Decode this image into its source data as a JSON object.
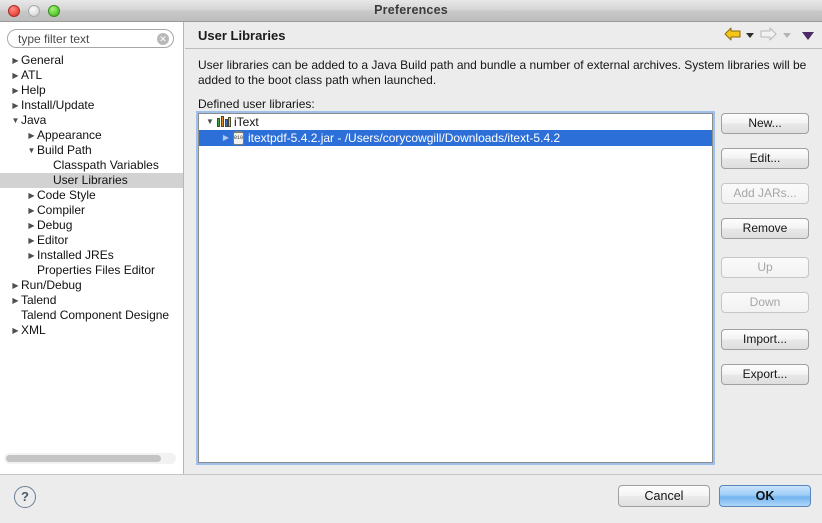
{
  "window": {
    "title": "Preferences"
  },
  "sidebar": {
    "filter": {
      "placeholder": "type filter text",
      "value": "",
      "clear_icon": "clear-circle-icon"
    },
    "items": [
      {
        "label": "General",
        "depth": 0,
        "twisty": "collapsed",
        "selected": false
      },
      {
        "label": "ATL",
        "depth": 0,
        "twisty": "collapsed",
        "selected": false
      },
      {
        "label": "Help",
        "depth": 0,
        "twisty": "collapsed",
        "selected": false
      },
      {
        "label": "Install/Update",
        "depth": 0,
        "twisty": "collapsed",
        "selected": false
      },
      {
        "label": "Java",
        "depth": 0,
        "twisty": "expanded",
        "selected": false
      },
      {
        "label": "Appearance",
        "depth": 1,
        "twisty": "collapsed",
        "selected": false
      },
      {
        "label": "Build Path",
        "depth": 1,
        "twisty": "expanded",
        "selected": false
      },
      {
        "label": "Classpath Variables",
        "depth": 2,
        "twisty": "none",
        "selected": false
      },
      {
        "label": "User Libraries",
        "depth": 2,
        "twisty": "none",
        "selected": true
      },
      {
        "label": "Code Style",
        "depth": 1,
        "twisty": "collapsed",
        "selected": false
      },
      {
        "label": "Compiler",
        "depth": 1,
        "twisty": "collapsed",
        "selected": false
      },
      {
        "label": "Debug",
        "depth": 1,
        "twisty": "collapsed",
        "selected": false
      },
      {
        "label": "Editor",
        "depth": 1,
        "twisty": "collapsed",
        "selected": false
      },
      {
        "label": "Installed JREs",
        "depth": 1,
        "twisty": "collapsed",
        "selected": false
      },
      {
        "label": "Properties Files Editor",
        "depth": 1,
        "twisty": "none",
        "selected": false
      },
      {
        "label": "Run/Debug",
        "depth": 0,
        "twisty": "collapsed",
        "selected": false
      },
      {
        "label": "Talend",
        "depth": 0,
        "twisty": "collapsed",
        "selected": false
      },
      {
        "label": "Talend Component Designe",
        "depth": 0,
        "twisty": "none",
        "selected": false
      },
      {
        "label": "XML",
        "depth": 0,
        "twisty": "collapsed",
        "selected": false
      }
    ],
    "scrollbar": "horizontal-scrollbar"
  },
  "main": {
    "page_title": "User Libraries",
    "nav": {
      "back_icon": "back-arrow-icon",
      "back_menu_icon": "chevron-down-icon",
      "forward_icon": "forward-arrow-icon",
      "forward_menu_icon": "chevron-down-icon",
      "menu_icon": "view-menu-chevron-icon"
    },
    "description": "User libraries can be added to a Java Build path and bundle a number of external archives. System libraries will be added to the boot class path when launched.",
    "defined_label": "Defined user libraries:",
    "tree": [
      {
        "label": "iText",
        "depth": 0,
        "twisty": "expanded",
        "icon": "library-books-icon",
        "selected": false
      },
      {
        "label": "itextpdf-5.4.2.jar - /Users/corycowgill/Downloads/itext-5.4.2",
        "depth": 1,
        "twisty": "collapsed",
        "icon": "jar-archive-icon",
        "selected": true
      }
    ],
    "buttons": [
      {
        "label": "New...",
        "enabled": true
      },
      {
        "label": "Edit...",
        "enabled": true
      },
      {
        "label": "Add JARs...",
        "enabled": false
      },
      {
        "label": "Remove",
        "enabled": true
      },
      {
        "label": "Up",
        "enabled": false
      },
      {
        "label": "Down",
        "enabled": false
      },
      {
        "label": "Import...",
        "enabled": true
      },
      {
        "label": "Export...",
        "enabled": true
      }
    ]
  },
  "footer": {
    "help_label": "?",
    "cancel_label": "Cancel",
    "ok_label": "OK"
  },
  "colors": {
    "selection_blue": "#2d6fd8",
    "sidebar_selection_gray": "#d2d2d2",
    "default_button_blue": "#9fcdf7",
    "window_background": "#ececec"
  }
}
